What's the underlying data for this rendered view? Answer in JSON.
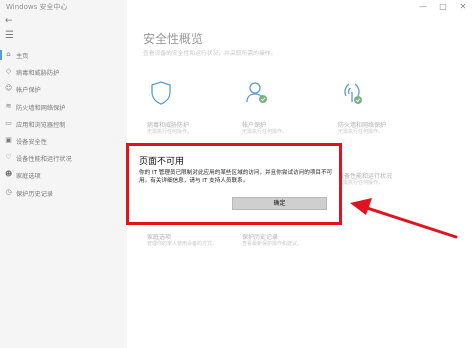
{
  "window": {
    "title": "Windows 安全中心",
    "minimize": "—",
    "maximize": "□",
    "close": "✕"
  },
  "sidebar": {
    "back": "←",
    "menu": "☰",
    "items": [
      {
        "label": "主页",
        "icon": "home-icon",
        "glyph": "⌂",
        "active": true
      },
      {
        "label": "病毒和威胁防护",
        "icon": "shield-icon",
        "glyph": "◇"
      },
      {
        "label": "帐户保护",
        "icon": "person-icon",
        "glyph": "☺"
      },
      {
        "label": "防火墙和网络保护",
        "icon": "wifi-icon",
        "glyph": "≋"
      },
      {
        "label": "应用和浏览器控制",
        "icon": "app-icon",
        "glyph": "▭"
      },
      {
        "label": "设备安全性",
        "icon": "device-icon",
        "glyph": "▣"
      },
      {
        "label": "设备性能和运行状况",
        "icon": "heart-icon",
        "glyph": "♡"
      },
      {
        "label": "家庭选项",
        "icon": "family-icon",
        "glyph": "☻"
      },
      {
        "label": "保护历史记录",
        "icon": "history-icon",
        "glyph": "◷"
      }
    ]
  },
  "main": {
    "title": "安全性概览",
    "subtitle": "查看设备的安全性和运行状况，并采取所需的操作。",
    "tiles": [
      {
        "title": "病毒和威胁防护",
        "status": "无需执行任何操作。"
      },
      {
        "title": "帐户保护",
        "status": "无需执行任何操作。"
      },
      {
        "title": "防火墙和网络保护",
        "status": "无需执行任何操作。"
      },
      {
        "title": "设备性能和运行状况",
        "status": "无需执行任何操作。"
      },
      {
        "title": "家庭选项",
        "status": "管理你的家人使用设备的方式。"
      },
      {
        "title": "保护历史记录",
        "status": "查看最新保护操作和建议。"
      }
    ]
  },
  "dialog": {
    "title": "页面不可用",
    "message": "你的 IT 管理员已限制对此应用的某些区域的访问，并且你尝试访问的项目不可用。有关详细信息，请与 IT 支持人员联系。",
    "ok_label": "确定"
  },
  "colors": {
    "highlight": "#e0141e",
    "accent": "#0067c0",
    "check": "#2e8b3e"
  }
}
